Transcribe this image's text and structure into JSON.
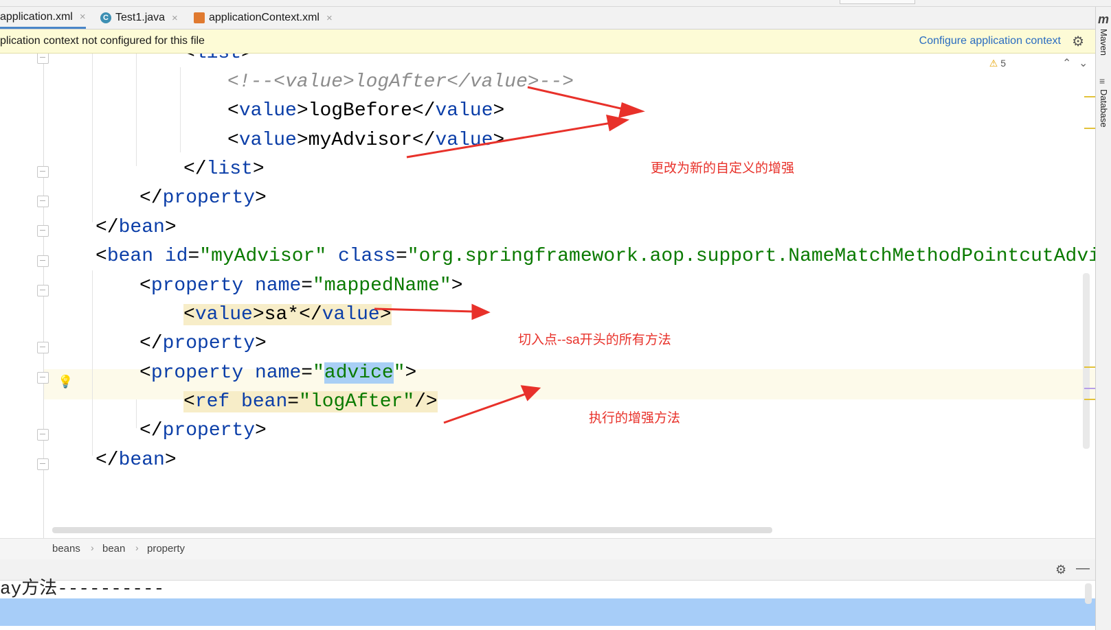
{
  "tabs": [
    {
      "label": "application.xml",
      "close": "×",
      "active": true
    },
    {
      "label": "Test1.java",
      "close": "×",
      "icon": "C"
    },
    {
      "label": "applicationContext.xml",
      "close": "×"
    }
  ],
  "banner": {
    "message": "plication context not configured for this file",
    "link": "Configure application context"
  },
  "editor": {
    "warning_count": "5",
    "lines": {
      "list_open": {
        "bracket_open": "<",
        "name": "list",
        "bracket_close": ">"
      },
      "comment": "<!--<value>logAfter</value>-->",
      "value1": {
        "open": "value",
        "text": "logBefore",
        "close": "value"
      },
      "value2": {
        "open": "value",
        "text": "myAdvisor",
        "close": "value"
      },
      "list_close": "list",
      "property_close1": "property",
      "bean_close1": "bean",
      "bean2": {
        "tag": "bean",
        "attr1": "id",
        "val1": "myAdvisor",
        "attr2": "class",
        "val2": "org.springframework.aop.support.NameMatchMethodPointcutAdvisor"
      },
      "prop_mapped": {
        "tag": "property",
        "attr": "name",
        "val": "mappedName"
      },
      "value_sa": {
        "open": "value",
        "text": "sa*",
        "close": "value"
      },
      "property_close2": "property",
      "prop_advice": {
        "tag": "property",
        "attr": "name",
        "val": "advice"
      },
      "ref": {
        "tag": "ref",
        "attr": "bean",
        "val": "logAfter"
      },
      "property_close3": "property",
      "bean_close2": "bean"
    }
  },
  "annotations": [
    "更改为新的自定义的增强",
    "切入点--sa开头的所有方法",
    "执行的增强方法"
  ],
  "breadcrumb": [
    "beans",
    "bean",
    "property"
  ],
  "breadcrumb_sep": "›",
  "console": {
    "text": "ay方法----------"
  },
  "right_bar": {
    "maven": "Maven",
    "database": "Database",
    "maven_icon": "m"
  },
  "icons": [
    "close-icon",
    "gear-icon",
    "warning-icon",
    "chevron-up-icon",
    "chevron-down-icon",
    "lightbulb-icon",
    "minimize-icon",
    "database-icon",
    "maven-icon"
  ]
}
